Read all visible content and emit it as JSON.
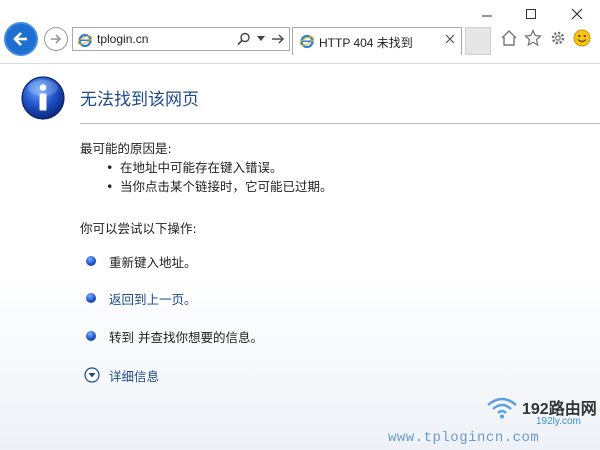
{
  "browser": {
    "address": "tplogin.cn",
    "tab_title": "HTTP 404 未找到"
  },
  "page": {
    "title": "无法找到该网页",
    "causes_heading": "最可能的原因是:",
    "causes": [
      "在地址中可能存在键入错误。",
      "当你点击某个链接时，它可能已过期。"
    ],
    "actions_heading": "你可以尝试以下操作:",
    "actions": [
      "重新键入地址。",
      "返回到上一页。",
      "转到 并查找你想要的信息。"
    ],
    "details_label": "详细信息"
  },
  "watermark": {
    "brand": "192路由网",
    "small": "192ly.com",
    "url": "www.tplogincn.com"
  },
  "colors": {
    "accent_blue": "#1e6fd0",
    "link_blue": "#1c4a8c"
  }
}
